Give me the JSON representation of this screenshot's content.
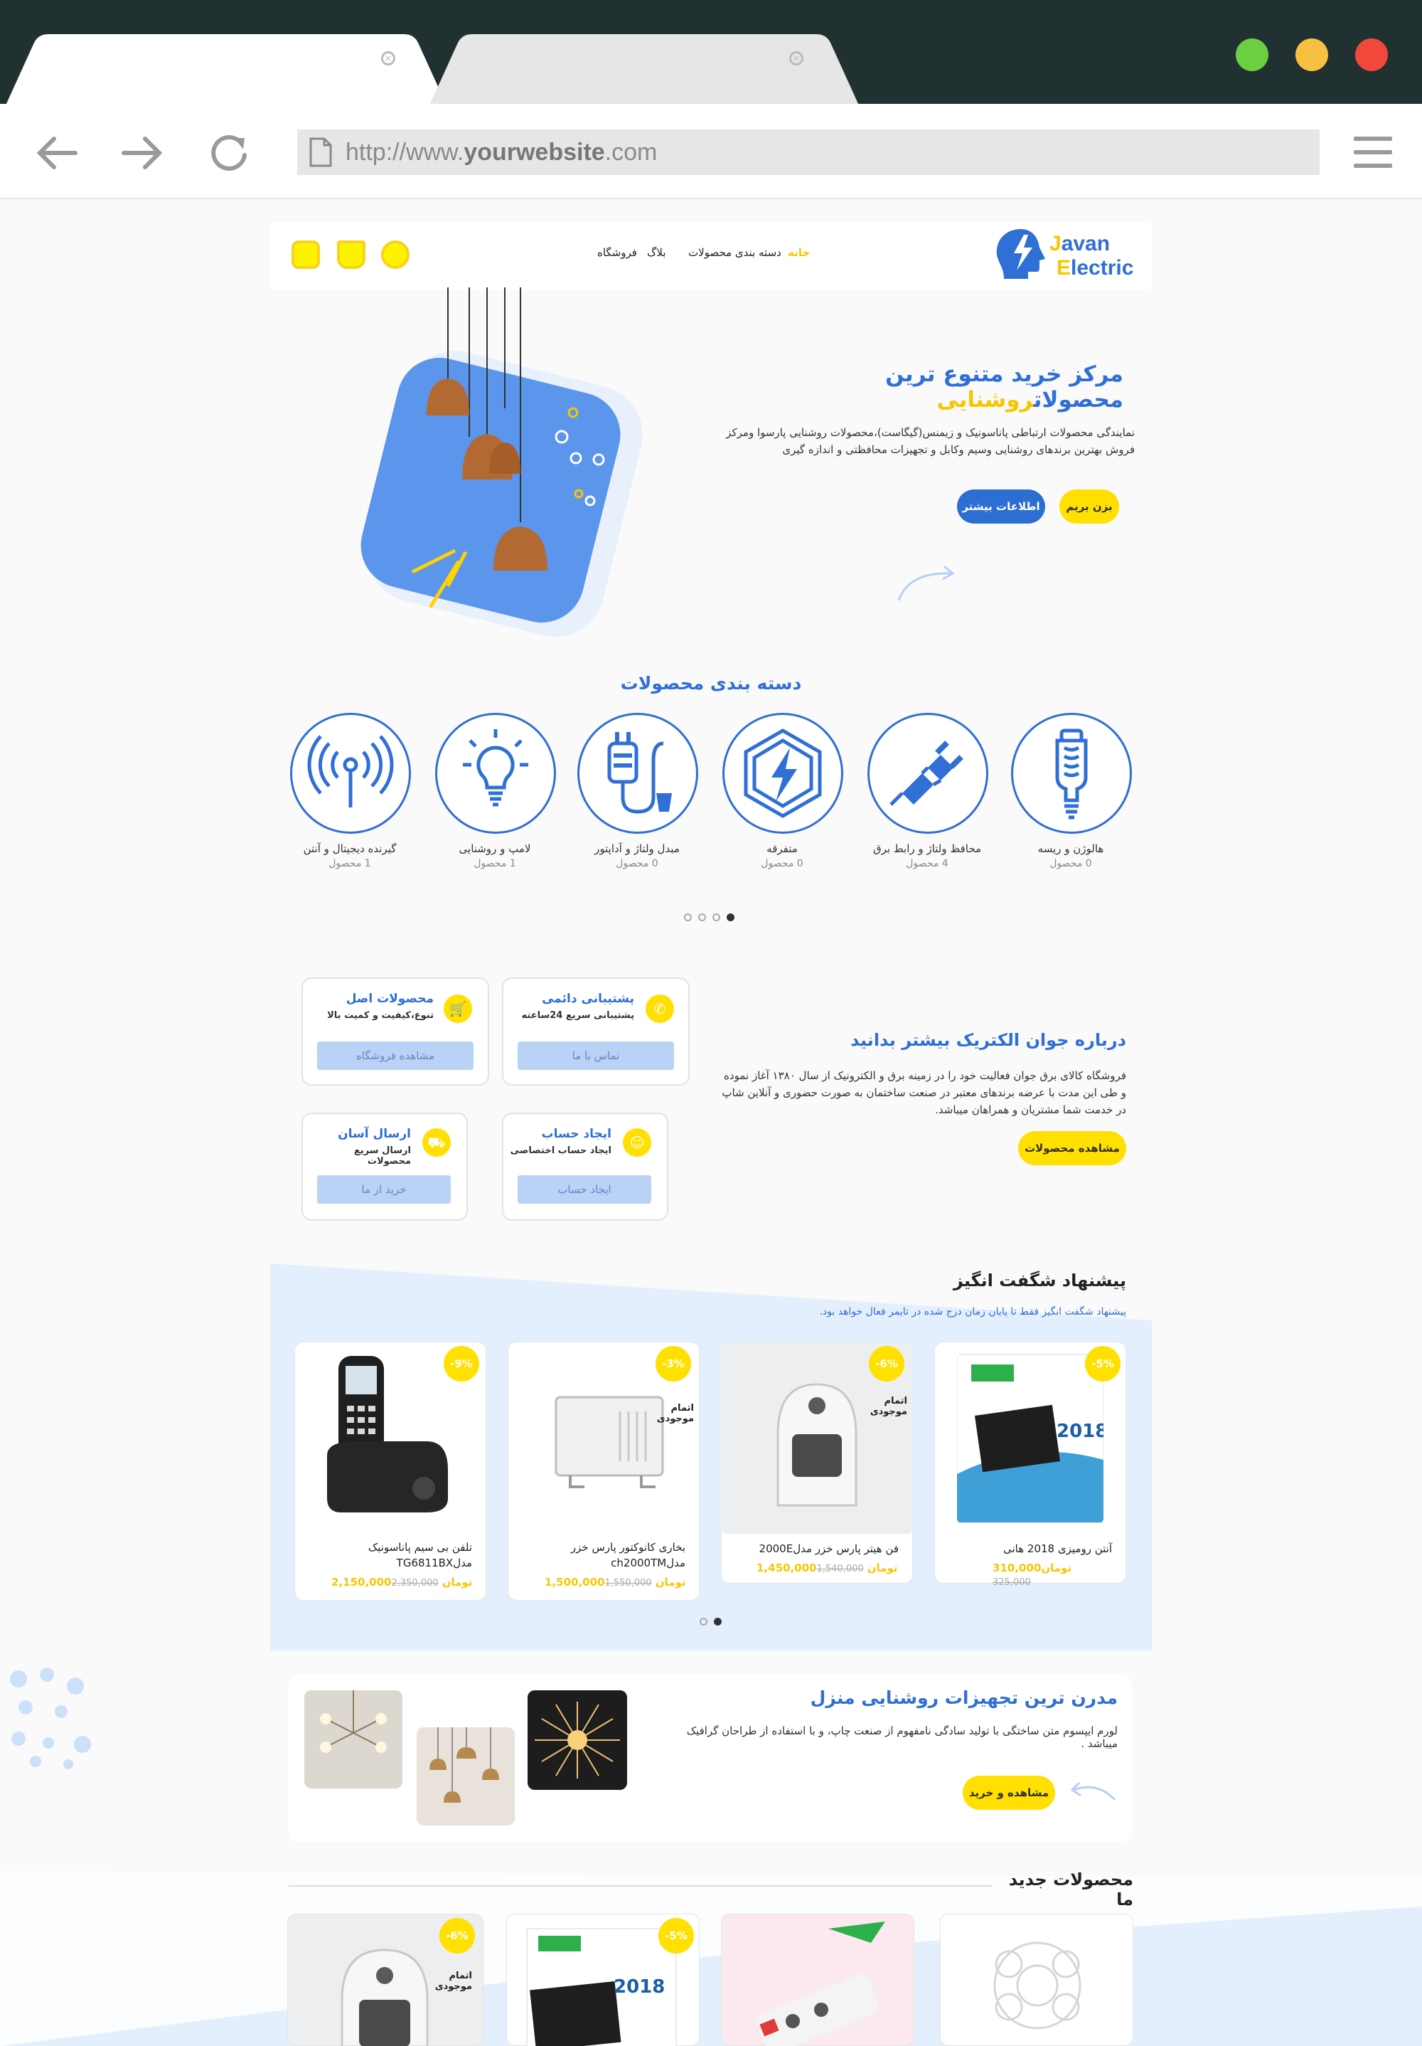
{
  "browser": {
    "url_prefix": "http://www.",
    "url_domain": "yourwebsite",
    "url_suffix": ".com",
    "tab_close_glyph": "×",
    "back_icon": "arrow-left-icon",
    "forward_icon": "arrow-right-icon",
    "reload_icon": "reload-icon",
    "window_colors": {
      "green": "#6ccf3f",
      "yellow": "#f7c040",
      "red": "#f0493c"
    }
  },
  "header": {
    "logo_line1": "Javan",
    "logo_line2": "Electric",
    "menu": [
      {
        "label": "خانه"
      },
      {
        "label": "دسته بندی محصولات"
      },
      {
        "label": "بلاگ"
      },
      {
        "label": "فروشگاه"
      }
    ]
  },
  "hero": {
    "title_part1": "مرکز خرید متنوع ترین ",
    "title_part2": "محصولات",
    "title_part3": "روشنایی",
    "description": "نمایندگی محصولات ارتباطی پاناسونیک و زیمنس(گیگاست)،محصولات روشنایی پارسوا ومرکز فروش بهترین برندهای روشنایی وسیم وکابل و تجهیزات محافظتی و اندازه گیری",
    "btn_primary": "بزن بریم",
    "btn_secondary": "اطلاعات بیشتر"
  },
  "categories": {
    "title": "دسته بندی محصولات",
    "items": [
      {
        "name": "هالوژن و ریسه",
        "count": "0 محصول",
        "icon": "halogen-bulb-icon"
      },
      {
        "name": "محافظ ولتاژ و رابط برق",
        "count": "4 محصول",
        "icon": "plug-icon"
      },
      {
        "name": "متفرقه",
        "count": "0 محصول",
        "icon": "lightning-hexagon-icon"
      },
      {
        "name": "مبدل ولتاژ و آداپتور",
        "count": "0 محصول",
        "icon": "adapter-icon"
      },
      {
        "name": "لامپ و روشنایی",
        "count": "1 محصول",
        "icon": "lightbulb-icon"
      },
      {
        "name": "گیرنده دیجیتال و آنتن",
        "count": "1 محصول",
        "icon": "antenna-icon"
      }
    ]
  },
  "features": [
    {
      "title": "پشتیبانی دائمی",
      "subtitle": "پشتیبانی سریع 24ساعته",
      "button": "تماس با ما",
      "icon": "phone-icon"
    },
    {
      "title": "محصولات اصل",
      "subtitle": "تنوع،کیفیت و کمیت بالا",
      "button": "مشاهده فروشگاه",
      "icon": "cart-icon"
    },
    {
      "title": "ایجاد حساب",
      "subtitle": "ایجاد حساب اختصاصی",
      "button": "ایجاد حساب",
      "icon": "user-icon"
    },
    {
      "title": "ارسال آسان",
      "subtitle": "ارسال سریع محصولات",
      "button": "خرید از ما",
      "icon": "truck-icon"
    }
  ],
  "about": {
    "title": "درباره جوان الکتریک بیشتر بدانید",
    "description": "فروشگاه کالای برق جوان فعالیت خود را در زمینه برق و الکترونیک از سال ۱۳۸۰ آغاز نموده و طی این مدت با عرضه برندهای معتبر در صنعت ساختمان به صورت حضوری و آنلاین شاپ در خدمت شما مشتریان و همراهان میباشد.",
    "button": "مشاهده محصولات"
  },
  "offers": {
    "title": "پیشنهاد شگفت انگیز",
    "subtitle": "پیشنهاد شگفت انگیز فقط تا پایان زمان درج شده در تایمر فعال خواهد بود.",
    "products": [
      {
        "name": "آنتن رومیزی 2018 هانی",
        "old_price": "325,000",
        "new_price": "310,000تومان",
        "discount": "-5%"
      },
      {
        "name": "فن هیتر پارس خزر مدل2000E",
        "old_price": "1,540,000",
        "new_price": "1,450,000تومان",
        "discount": "-6%"
      },
      {
        "name": "بخاری کانوکتور پارس خزر مدلch2000TM",
        "old_price": "1,550,000",
        "new_price": "1,500,000تومان",
        "discount": "-3%"
      },
      {
        "name": "تلفن بی سیم پاناسونیک مدلTG6811BX",
        "old_price": "2,350,000",
        "new_price": "2,150,000تومان",
        "discount": "-9%"
      }
    ],
    "old_suffix": "تومان",
    "out_of_stock": "اتمام موجودی",
    "antenna_year": "2018"
  },
  "banner": {
    "title": "مدرن ترین تجهیزات روشنایی منزل",
    "description": "لورم ایپسوم متن ساختگی با تولید سادگی نامفهوم از صنعت چاپ، و با استفاده از طراحان گرافیک میباشد .",
    "button": "مشاهده و خرید"
  },
  "new_products": {
    "title": "محصولات جدید ما",
    "discounts": [
      "-6%",
      "-5%"
    ]
  },
  "colors": {
    "accent_yellow": "#ffe000",
    "brand_blue": "#2f6fd6",
    "chrome_dark": "#213131"
  }
}
